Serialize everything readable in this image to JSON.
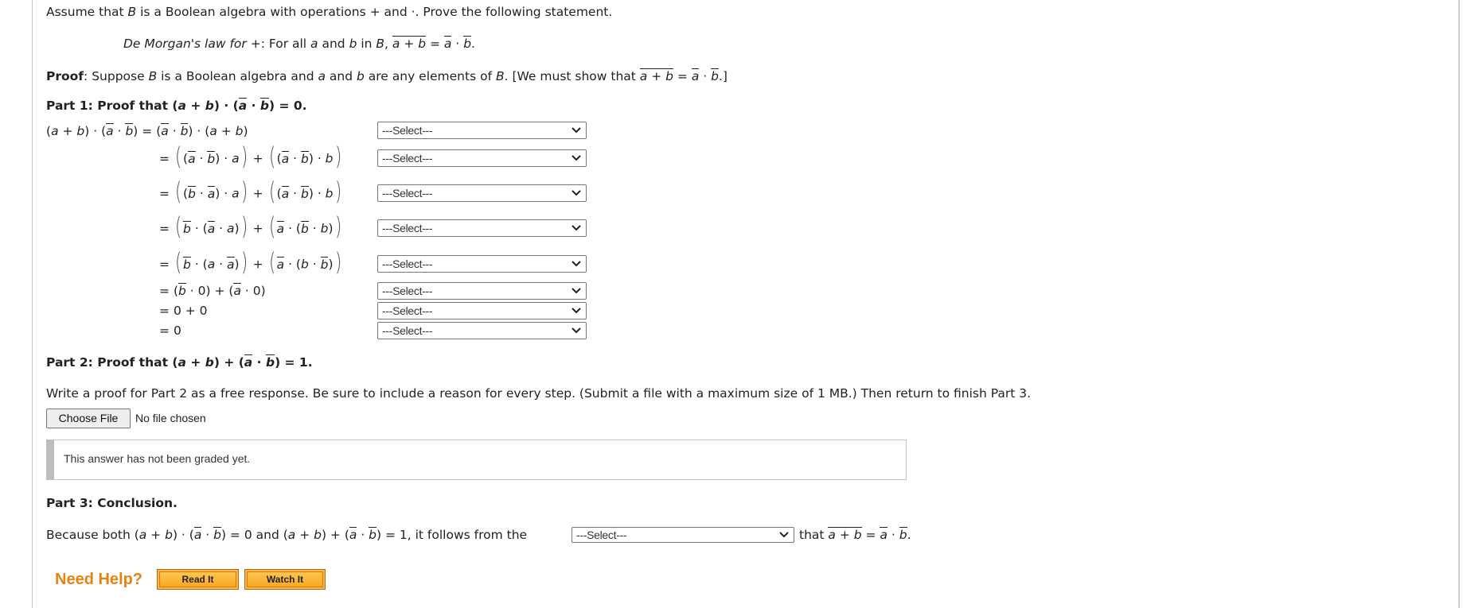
{
  "intro": {
    "text_1": "Assume that ",
    "B": "B",
    "text_2": " is a Boolean algebra with operations + and ·. Prove the following statement."
  },
  "statement": {
    "law_name": "De Morgan's law for",
    "plus": " +",
    "text_1": ": For all ",
    "a": "a",
    "and": " and ",
    "b": "b",
    "in": " in ",
    "B": "B",
    "comma": ", ",
    "lhs": "a + b",
    "eq": " = ",
    "abar": "a",
    "dot": " · ",
    "bbar": "b",
    "end": "."
  },
  "proof_intro": {
    "label": "Proof",
    "text_1": ": Suppose ",
    "B": "B",
    "text_2": " is a Boolean algebra and ",
    "a": "a",
    "text_3": " and ",
    "b": "b",
    "text_4": " are any elements of ",
    "B2": "B",
    "text_5": ". [We must show that ",
    "lhs": "a + b",
    "eq": " = ",
    "abar": "a",
    "dot": " · ",
    "bbar": "b",
    "end": ".]"
  },
  "part1": {
    "label": "Part 1",
    "title_text": ": Proof that ",
    "expr_1": "(",
    "a": "a",
    "plus": " + ",
    "b": "b",
    "expr_2": ") · (",
    "abar": "a",
    "dot": " · ",
    "bbar": "b",
    "expr_3": ") = 0."
  },
  "part1_steps": [
    {
      "expression": "(a + b) · (ā · b̄) = (ā · b̄) · (a + b)",
      "reason": "---Select---"
    },
    {
      "expression": "= ((ā · b̄) · a) + ((ā · b̄) · b)",
      "reason": "---Select---"
    },
    {
      "expression": "= ((b̄ · ā) · a) + ((ā · b̄) · b)",
      "reason": "---Select---"
    },
    {
      "expression": "= (b̄ · (ā · a)) + (ā · (b̄ · b))",
      "reason": "---Select---"
    },
    {
      "expression": "= (b̄ · (a · ā)) + (ā · (b · b̄))",
      "reason": "---Select---"
    },
    {
      "expression": "= (b̄ · 0) + (ā · 0)",
      "reason": "---Select---"
    },
    {
      "expression": "= 0 + 0",
      "reason": "---Select---"
    },
    {
      "expression": "= 0",
      "reason": "---Select---"
    }
  ],
  "math": {
    "eq": "=",
    "a": "a",
    "b": "b",
    "plus": " + ",
    "dot": " · ",
    "lp": "(",
    "rp": ")",
    "zero": "0",
    "zero_plus_zero": "0 + 0"
  },
  "part2": {
    "label": "Part 2",
    "title_text": ": Proof that (",
    "a": "a",
    "plus": " + ",
    "b": "b",
    "mid": ") + (",
    "abar": "a",
    "dot": " · ",
    "bbar": "b",
    "end": ") = 1.",
    "instructions": "Write a proof for Part 2 as a free response. Be sure to include a reason for every step. (Submit a file with a maximum size of 1 MB.) Then return to finish Part 3.",
    "choose_file_label": "Choose File",
    "file_status": "No file chosen",
    "grading_status": "This answer has not been graded yet."
  },
  "part3": {
    "label": "Part 3",
    "title_text": ": Conclusion.",
    "text_1": "Because both (",
    "a": "a",
    "plus": " + ",
    "b": "b",
    "t2": ") · (",
    "abar": "a",
    "dot": " · ",
    "bbar": "b",
    "t3": ") = 0 and (",
    "t4": ") + (",
    "t5": ") = 1, it follows from the",
    "select_value": "---Select---",
    "t6": " that ",
    "lhs": "a + b",
    "eq": " = ",
    "end": "."
  },
  "help": {
    "label": "Need Help?",
    "read_it": "Read It",
    "watch_it": "Watch It",
    "accent_color": "#E8820E"
  }
}
